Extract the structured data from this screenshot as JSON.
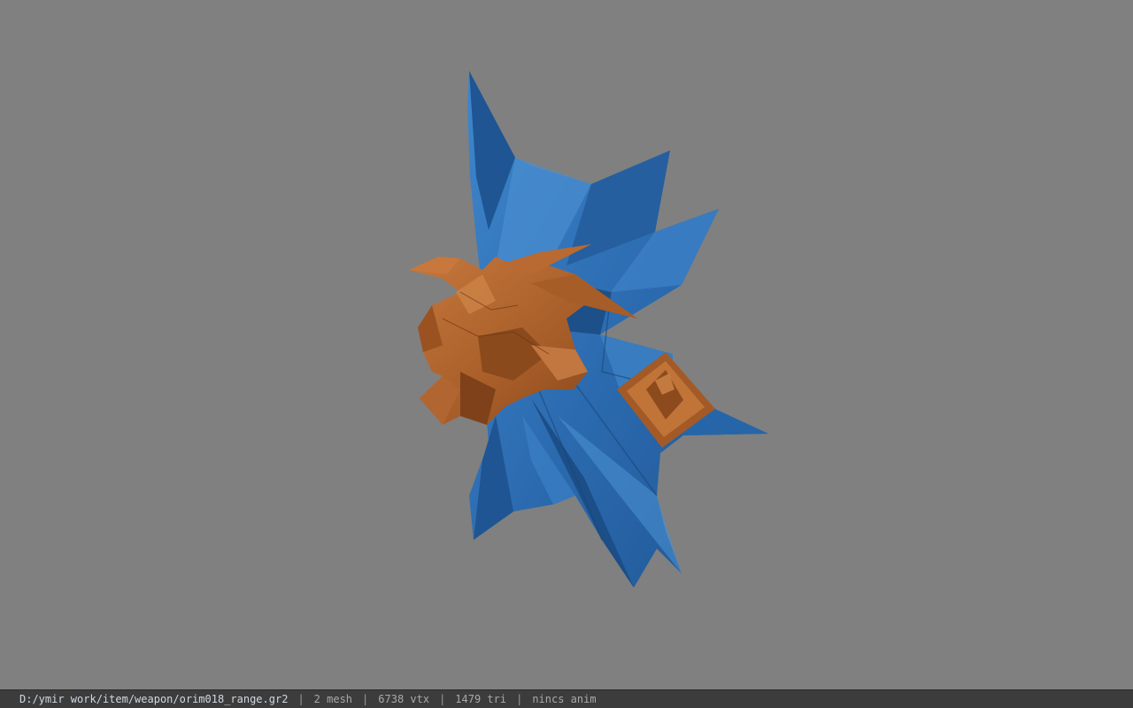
{
  "viewer": {
    "background_color": "#808080",
    "model_colors": {
      "blade_blue": "#2e6fb3",
      "blade_blue_dark": "#1f4f8a",
      "blade_blue_light": "#4a8fd0",
      "ornament_orange": "#b0652e",
      "ornament_orange_dark": "#7a3f17",
      "ornament_orange_light": "#d08648"
    }
  },
  "status": {
    "file_path": "D:/ymir work/item/weapon/orim018_range.gr2",
    "separator": "|",
    "mesh_count": "2 mesh",
    "vertex_count": "6738 vtx",
    "triangle_count": "1479 tri",
    "anim_status": "nincs anim"
  }
}
